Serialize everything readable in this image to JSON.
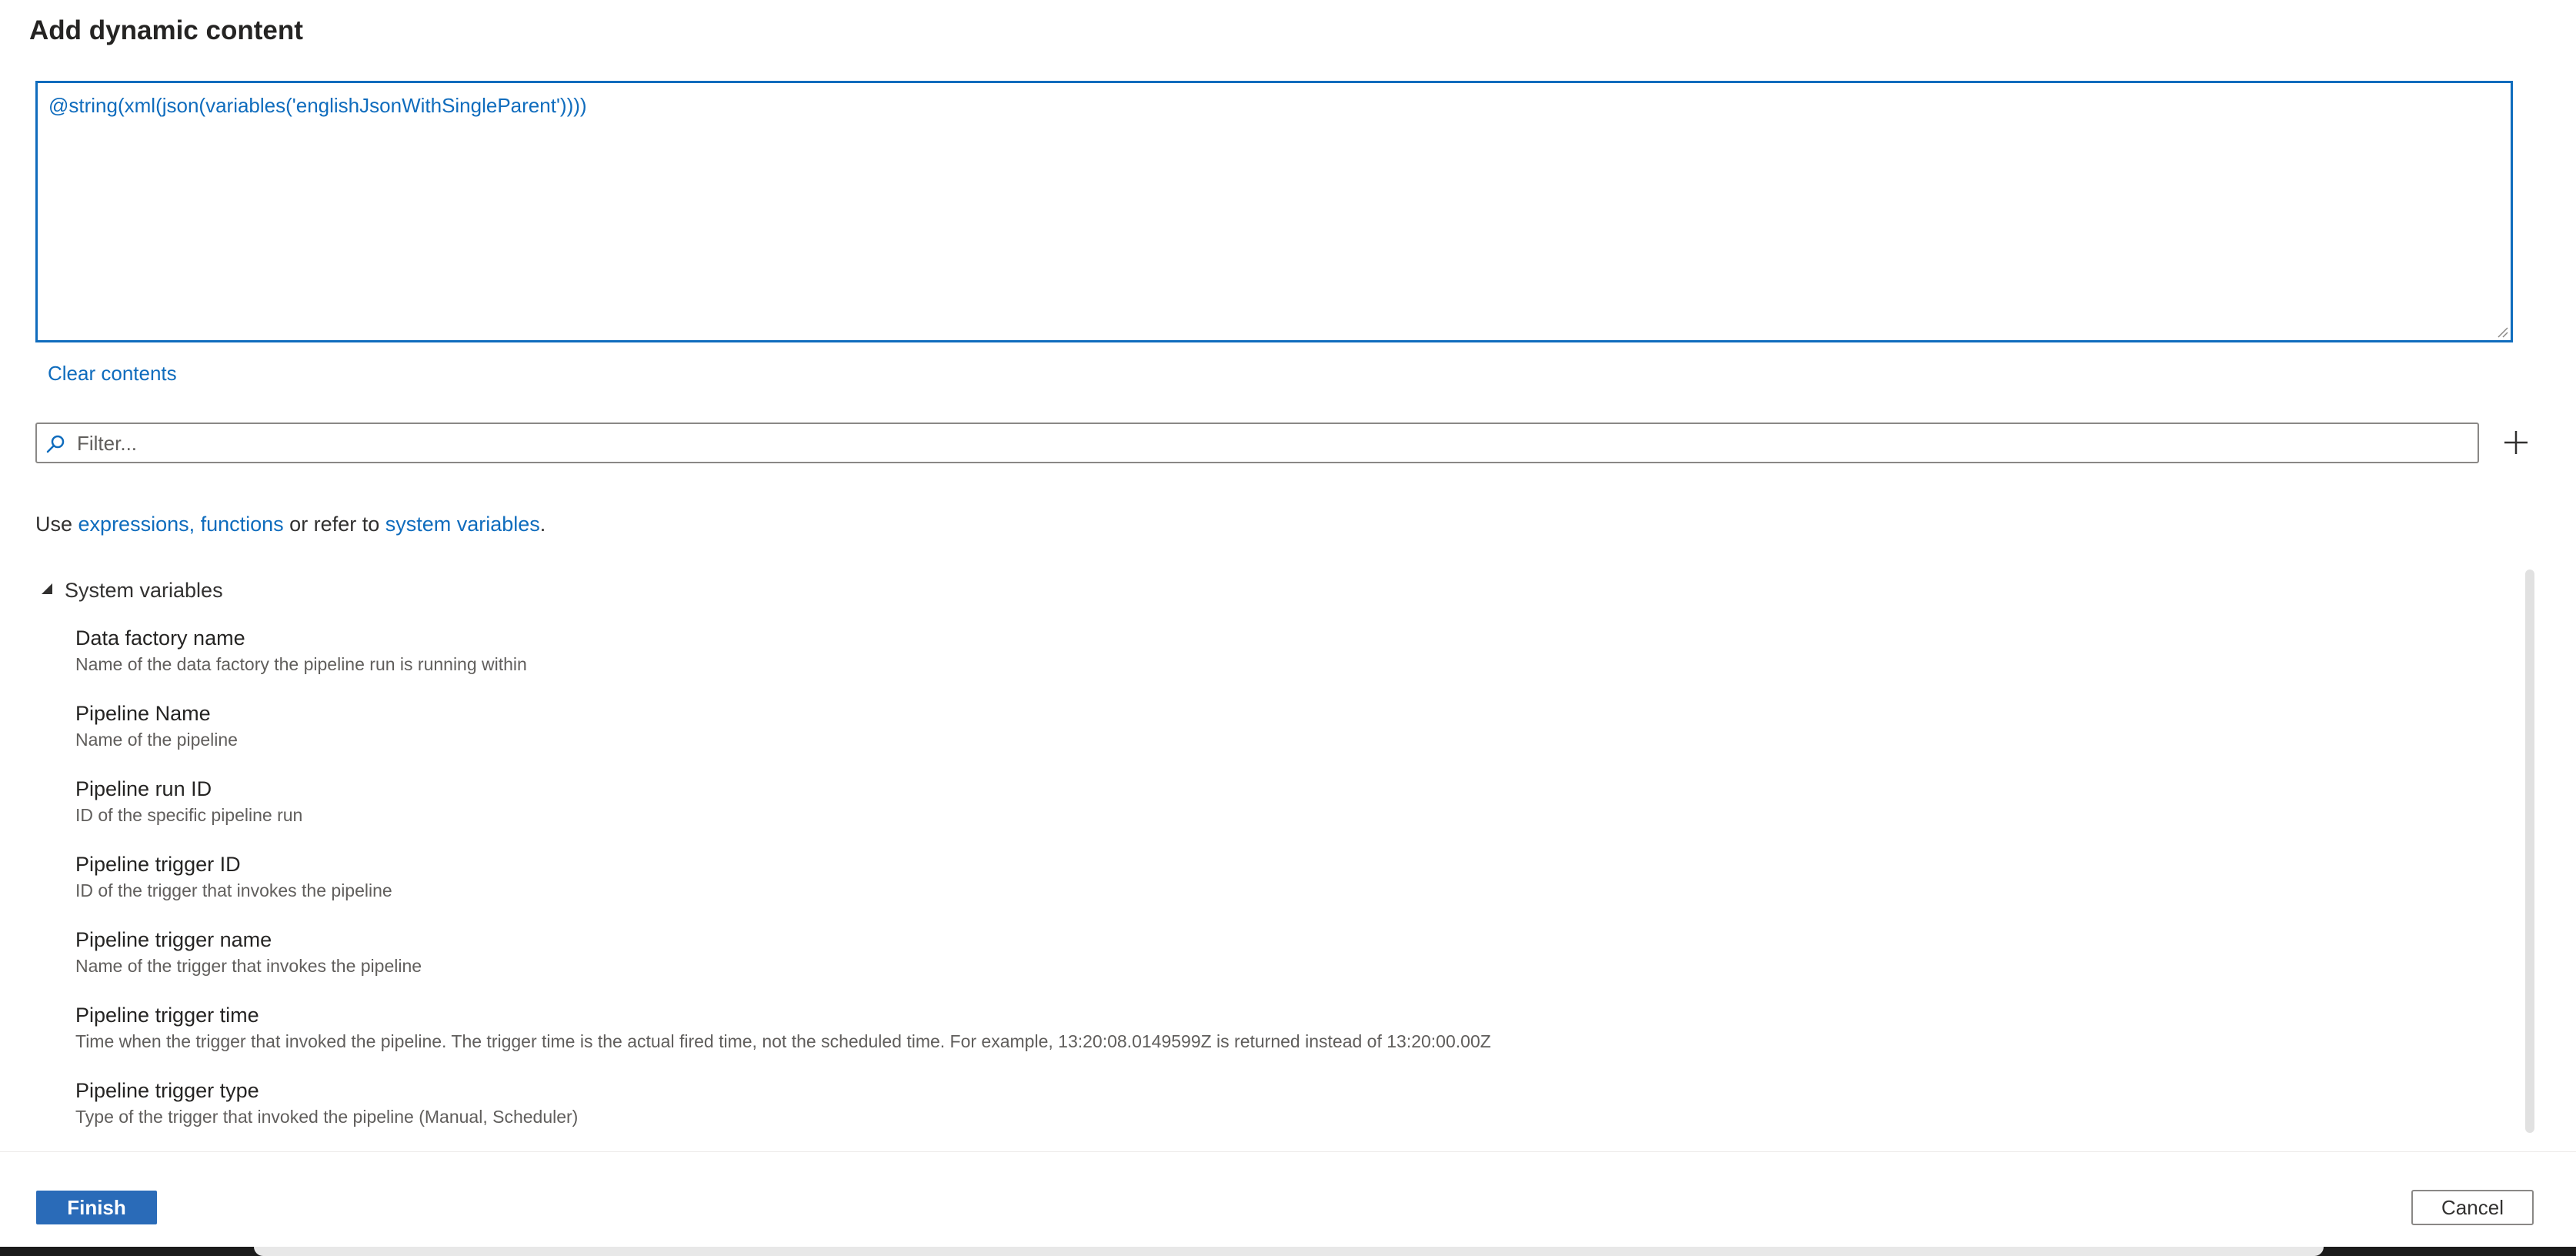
{
  "dialog": {
    "title": "Add dynamic content"
  },
  "editor": {
    "value": "@string(xml(json(variables('englishJsonWithSingleParent'))))"
  },
  "clear_contents_label": "Clear contents",
  "filter": {
    "placeholder": "Filter...",
    "icon": "search-icon"
  },
  "add_icon": "plus-icon",
  "hint": {
    "prefix": "Use ",
    "link1": "expressions, functions",
    "middle": " or refer to ",
    "link2": "system variables",
    "suffix": "."
  },
  "system_variables": {
    "header": "System variables",
    "items": [
      {
        "name": "Data factory name",
        "description": "Name of the data factory the pipeline run is running within"
      },
      {
        "name": "Pipeline Name",
        "description": "Name of the pipeline"
      },
      {
        "name": "Pipeline run ID",
        "description": "ID of the specific pipeline run"
      },
      {
        "name": "Pipeline trigger ID",
        "description": "ID of the trigger that invokes the pipeline"
      },
      {
        "name": "Pipeline trigger name",
        "description": "Name of the trigger that invokes the pipeline"
      },
      {
        "name": "Pipeline trigger time",
        "description": "Time when the trigger that invoked the pipeline. The trigger time is the actual fired time, not the scheduled time. For example, 13:20:08.0149599Z is returned instead of 13:20:00.00Z"
      },
      {
        "name": "Pipeline trigger type",
        "description": "Type of the trigger that invoked the pipeline (Manual, Scheduler)"
      }
    ]
  },
  "footer": {
    "finish_label": "Finish",
    "cancel_label": "Cancel"
  },
  "colors": {
    "accent": "#0f6cbd",
    "primary_button": "#2a6bb8"
  }
}
